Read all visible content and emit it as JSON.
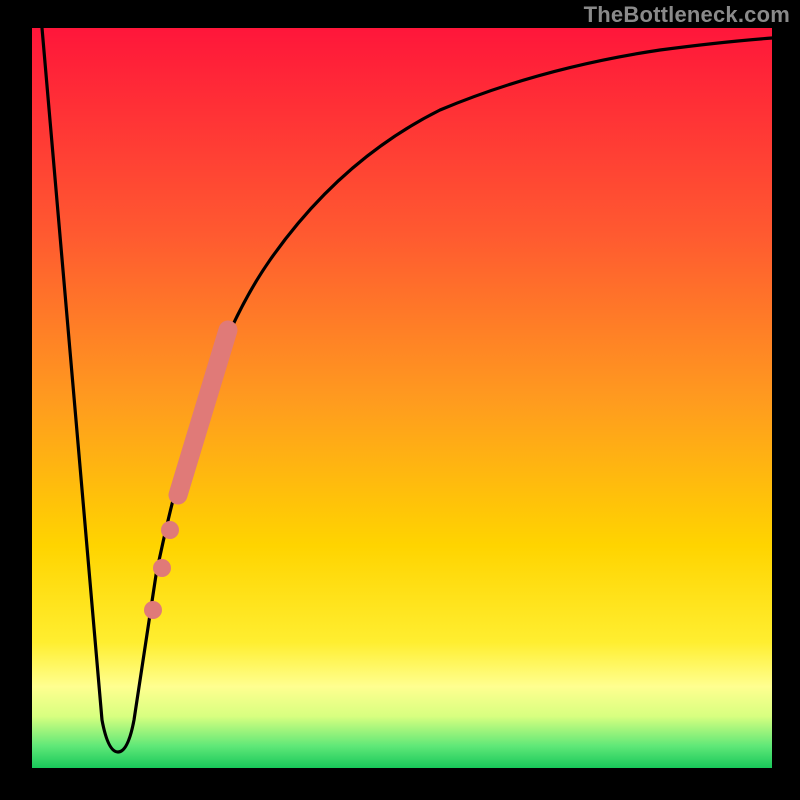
{
  "watermark": "TheBottleneck.com",
  "colors": {
    "frame": "#000000",
    "gradient_top": "#ff163a",
    "gradient_mid1": "#ff812b",
    "gradient_mid2": "#ffd400",
    "gradient_band": "#ffff90",
    "gradient_green": "#18e06a",
    "curve": "#000000",
    "marker": "#e07a78",
    "watermark": "#8a8a8a"
  },
  "chart_data": {
    "type": "line",
    "title": "",
    "xlabel": "",
    "ylabel": "",
    "xlim": [
      0,
      100
    ],
    "ylim": [
      0,
      100
    ],
    "grid": false,
    "legend": false,
    "annotations": [
      "TheBottleneck.com"
    ],
    "series": [
      {
        "name": "bottleneck-curve",
        "x": [
          0,
          8,
          9,
          11,
          12,
          15,
          18,
          21,
          24,
          28,
          32,
          38,
          45,
          55,
          65,
          78,
          90,
          100
        ],
        "y": [
          100,
          7,
          4,
          4,
          7,
          21,
          35,
          48,
          58,
          67,
          74,
          81,
          86,
          90,
          93,
          95,
          96.5,
          97
        ]
      }
    ],
    "markers": [
      {
        "name": "highlight-segment",
        "type": "thick-line",
        "x_range": [
          20,
          26
        ],
        "y_range": [
          43,
          63
        ]
      },
      {
        "name": "highlight-dots",
        "type": "dots",
        "points": [
          {
            "x": 18.2,
            "y": 36
          },
          {
            "x": 17.0,
            "y": 30
          },
          {
            "x": 15.7,
            "y": 24
          }
        ]
      }
    ]
  }
}
